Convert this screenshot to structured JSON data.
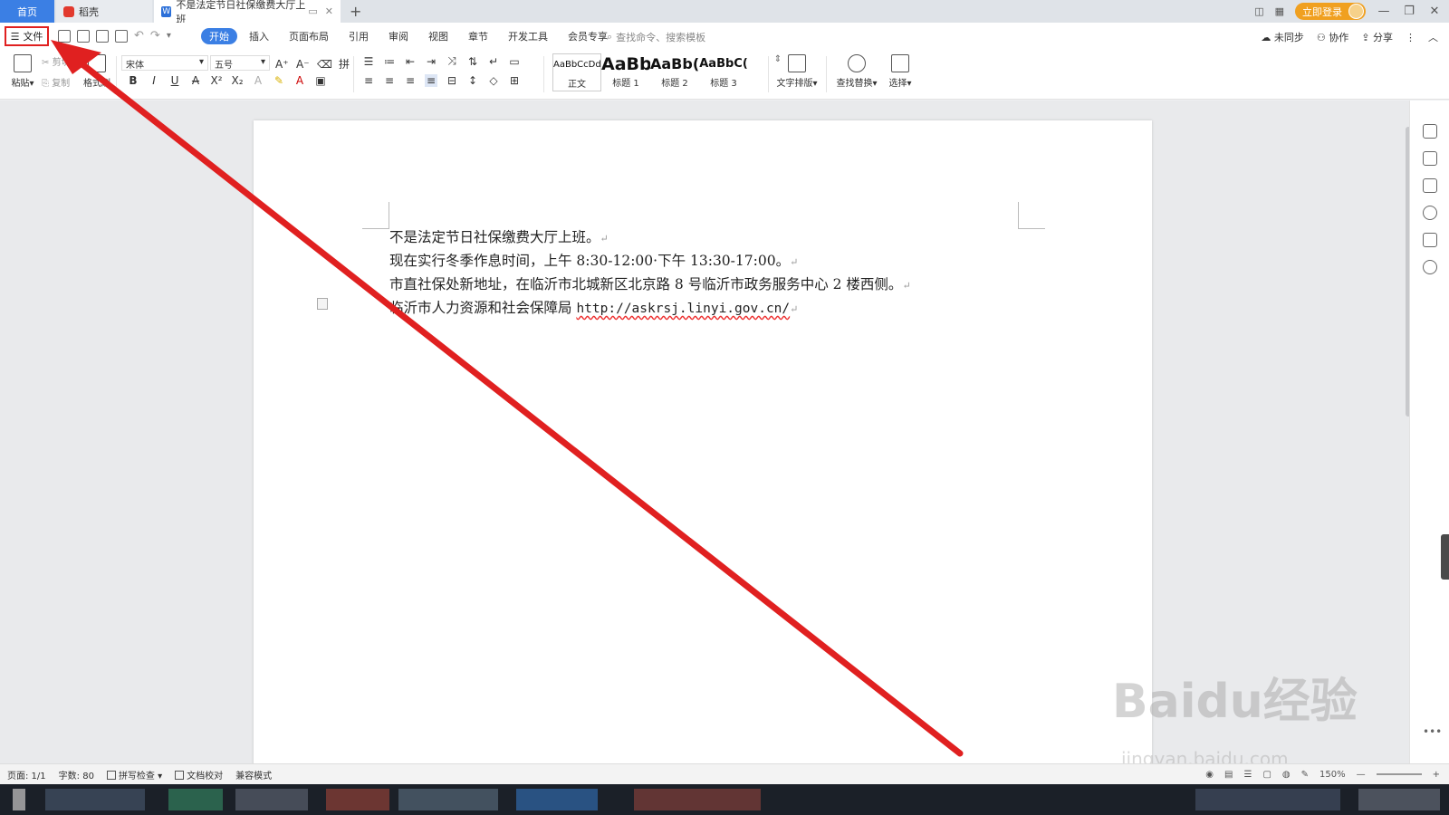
{
  "titlebar": {
    "tabs": [
      {
        "label": "首页"
      },
      {
        "label": "稻壳"
      },
      {
        "label": "不是法定节日社保缴费大厅上班"
      }
    ],
    "login_label": "立即登录"
  },
  "menubar": {
    "file_label": "文件",
    "items": [
      "开始",
      "插入",
      "页面布局",
      "引用",
      "审阅",
      "视图",
      "章节",
      "开发工具",
      "会员专享"
    ],
    "search_placeholder": "查找命令、搜索模板",
    "right_actions": [
      "未同步",
      "协作",
      "分享"
    ]
  },
  "ribbon": {
    "paste_label": "粘贴",
    "cut_label": "剪切",
    "copy_label": "复制",
    "format_painter_label": "格式刷",
    "font_name": "宋体",
    "font_size": "五号",
    "styles": [
      {
        "sample": "AaBbCcDd",
        "name": "正文"
      },
      {
        "sample": "AaBb",
        "name": "标题 1"
      },
      {
        "sample": "AaBb(",
        "name": "标题 2"
      },
      {
        "sample": "AaBbC(",
        "name": "标题 3"
      }
    ],
    "text_layout_label": "文字排版",
    "find_replace_label": "查找替换",
    "select_label": "选择"
  },
  "document": {
    "lines": [
      "不是法定节日社保缴费大厅上班。",
      "现在实行冬季作息时间，上午 8:30-12:00·下午 13:30-17:00。",
      "市直社保处新地址，在临沂市北城新区北京路 8 号临沂市政务服务中心 2 楼西侧。"
    ],
    "line4_prefix": "临沂市人力资源和社会保障局 ",
    "line4_url": "http://askrsj.linyi.gov.cn/"
  },
  "statusbar": {
    "page": "页面: 1/1",
    "words": "字数: 80",
    "spellcheck": "拼写检查",
    "proofread": "文档校对",
    "compat": "兼容模式",
    "zoom": "150%"
  },
  "watermark": {
    "main": "Baidu经验",
    "sub": "jingyan.baidu.com"
  },
  "colors": {
    "accent": "#3b7fe4",
    "annotation": "#e02020",
    "login": "#f0a020"
  }
}
